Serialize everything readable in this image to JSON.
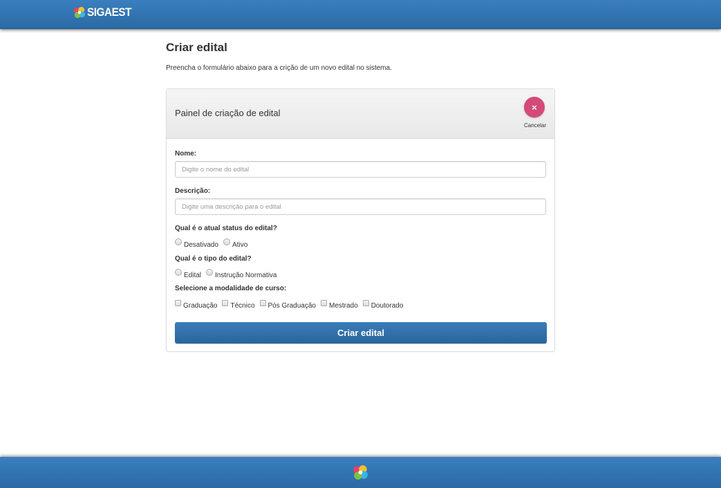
{
  "app": {
    "brand_name": "SIGAEST",
    "icons": {
      "logo": "sigaest-pinwheel-logo",
      "cancel": "close-icon"
    },
    "colors": {
      "header": "#2f72b0",
      "accent_button": "#2c6aa3",
      "cancel": "#d44a78"
    }
  },
  "page": {
    "title": "Criar edital",
    "description": "Preencha o formulário abaixo para a crição de um novo edital no sistema."
  },
  "panel": {
    "title": "Painel de criação de edital",
    "cancel_label": "Cancelar",
    "cancel_icon": "×"
  },
  "form": {
    "nome": {
      "label": "Nome:",
      "placeholder": "Digite o nome do edital",
      "value": ""
    },
    "descricao": {
      "label": "Descrição:",
      "placeholder": "Digite uma descrição para o edital",
      "value": ""
    },
    "status": {
      "label": "Qual é o atual status do edital?",
      "options": [
        {
          "label": "Desativado",
          "checked": false
        },
        {
          "label": "Ativo",
          "checked": false
        }
      ]
    },
    "tipo": {
      "label": "Qual é o tipo do edital?",
      "options": [
        {
          "label": "Edital",
          "checked": false
        },
        {
          "label": "Instrução Normativa",
          "checked": false
        }
      ]
    },
    "modalidade": {
      "label": "Selecione a modalidade de curso:",
      "options": [
        {
          "label": "Graduação",
          "checked": false
        },
        {
          "label": "Técnico",
          "checked": false
        },
        {
          "label": "Pós Graduação",
          "checked": false
        },
        {
          "label": "Mestrado",
          "checked": false
        },
        {
          "label": "Doutorado",
          "checked": false
        }
      ]
    },
    "submit_label": "Criar edital"
  }
}
